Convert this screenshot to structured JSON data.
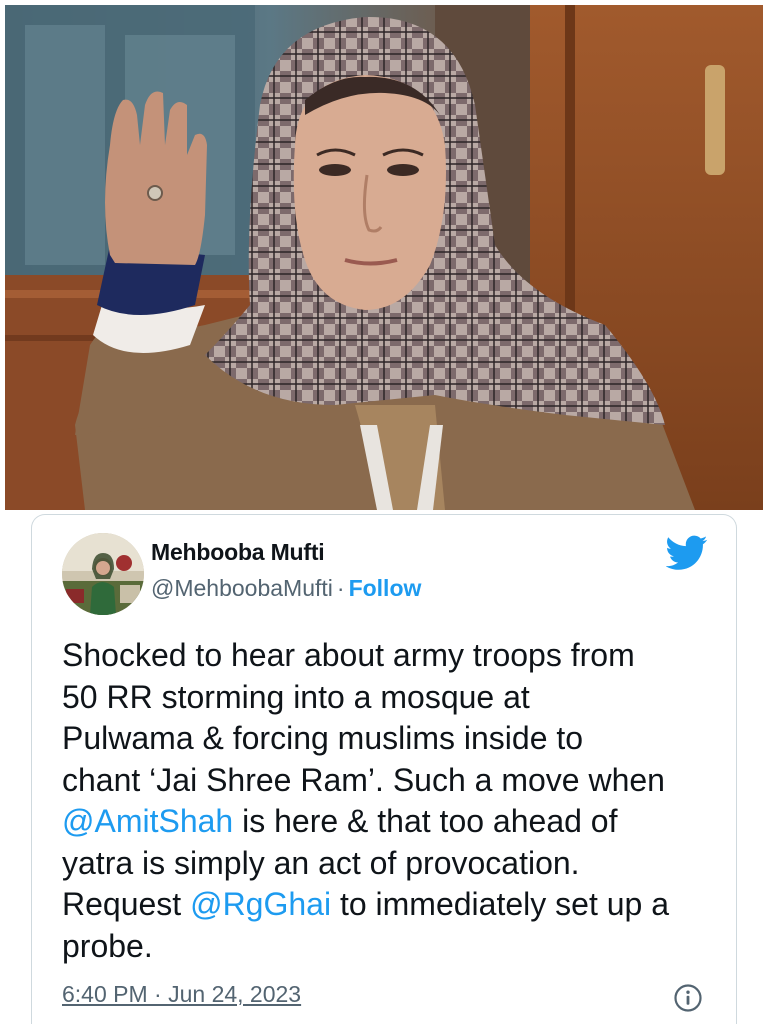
{
  "photo": {
    "subject": "Woman in checked headscarf raising right hand"
  },
  "tweet": {
    "author": {
      "name": "Mehbooba Mufti",
      "handle": "@MehboobaMufti",
      "separator": "·",
      "follow_label": "Follow",
      "avatar_icon": "profile-photo"
    },
    "brand_icon": "twitter-bird-icon",
    "colors": {
      "accent": "#1d9bf0",
      "text": "#0f1419",
      "muted": "#536471",
      "border": "#cfd9de"
    },
    "body": {
      "line1": "Shocked to hear about army troops from",
      "line2": "50 RR storming into a mosque at",
      "line3": "Pulwama & forcing muslims inside to",
      "line4": "chant ‘Jai Shree Ram’. Such a move  when",
      "line5_mention": "@AmitShah",
      "line5_rest": " is here & that too  ahead of",
      "line6": "yatra is simply an act of provocation.",
      "line7_pre": "Request ",
      "line7_mention": "@RgGhai",
      "line7_rest": " to immediately set up a",
      "line8": "probe."
    },
    "timestamp": "6:40 PM · Jun 24, 2023",
    "info_icon": "info-icon"
  }
}
